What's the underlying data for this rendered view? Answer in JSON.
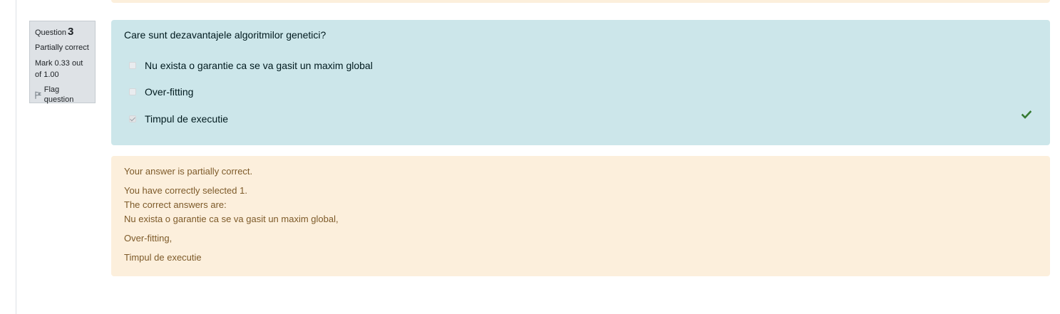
{
  "question": {
    "label": "Question",
    "number": "3",
    "state": "Partially correct",
    "grade": "Mark 0.33 out of 1.00",
    "flag_label": "Flag question",
    "text": "Care sunt dezavantajele algoritmilor genetici?",
    "options": [
      {
        "label": "Nu exista o garantie ca se va gasit un maxim global",
        "checked": false
      },
      {
        "label": "Over-fitting",
        "checked": false
      },
      {
        "label": "Timpul de executie",
        "checked": true
      }
    ],
    "correct_icon": "check-icon",
    "colors": {
      "formulation_bg": "#cce6ea",
      "feedback_bg": "#fcefdc",
      "correct": "#357a32"
    }
  },
  "feedback": {
    "summary": "Your answer is partially correct.",
    "selected": "You have correctly selected 1.",
    "answers_intro": "The correct answers are:",
    "answers": [
      "Nu exista o garantie ca se va gasit un maxim global,",
      "Over-fitting,",
      "Timpul de executie"
    ]
  }
}
